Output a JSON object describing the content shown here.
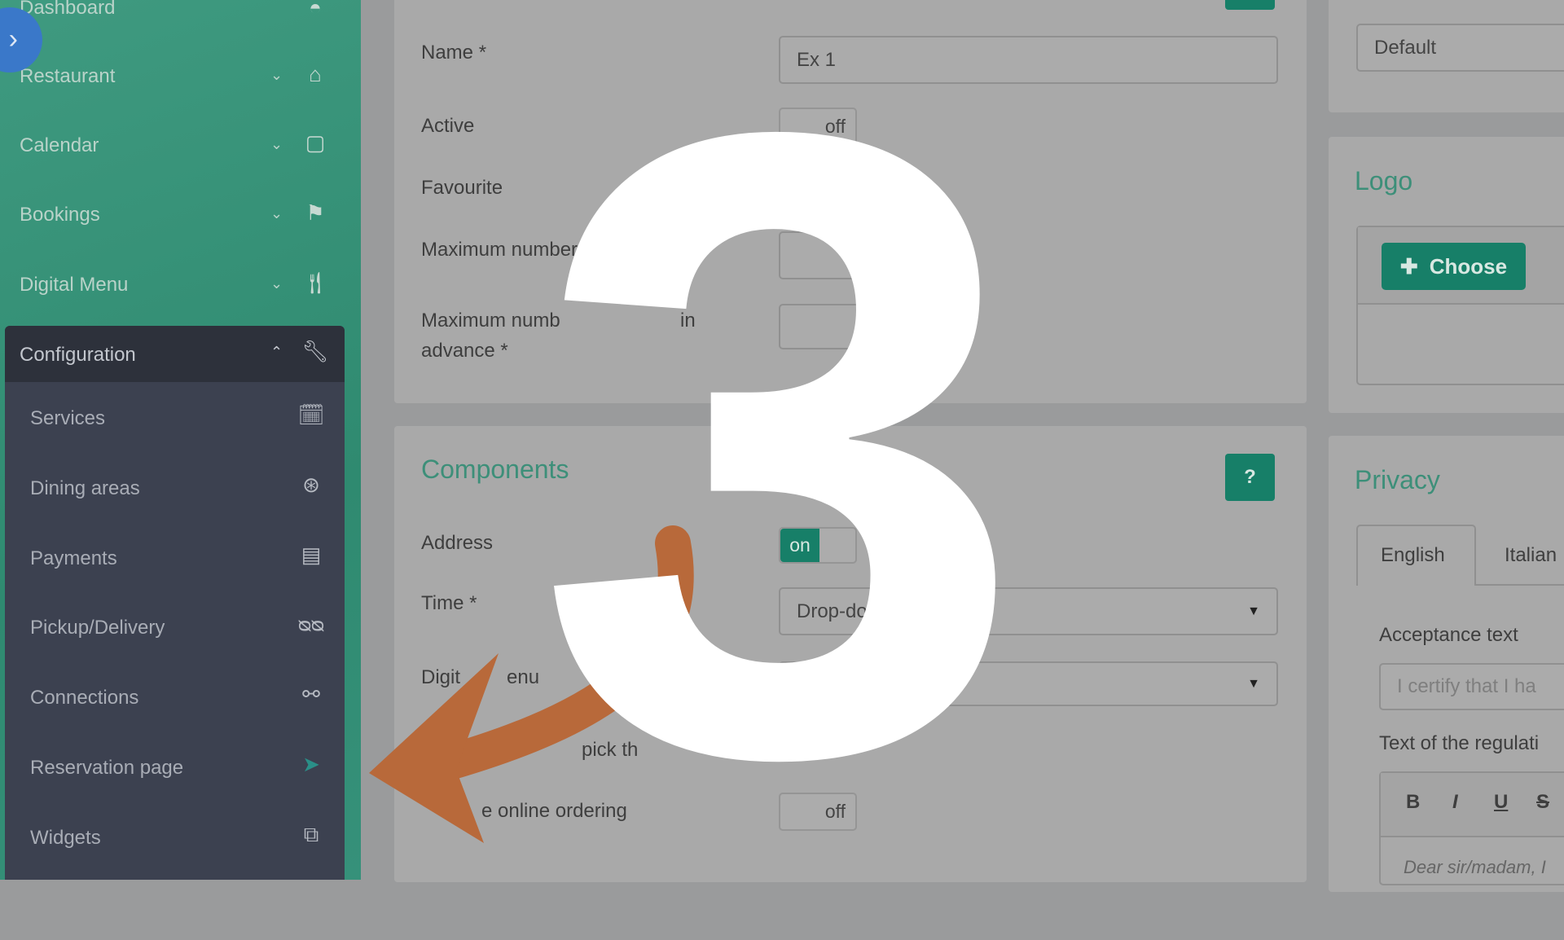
{
  "sidebar": {
    "items": [
      {
        "label": "Dashboard",
        "icon": "dashboard-icon"
      },
      {
        "label": "Restaurant",
        "icon": "home-icon"
      },
      {
        "label": "Calendar",
        "icon": "calendar-icon"
      },
      {
        "label": "Bookings",
        "icon": "flag-icon"
      },
      {
        "label": "Digital Menu",
        "icon": "cutlery-icon"
      }
    ],
    "config": {
      "label": "Configuration",
      "icon": "wrench-icon",
      "items": [
        {
          "label": "Services",
          "icon": "calendar-check-icon"
        },
        {
          "label": "Dining areas",
          "icon": "dining-area-icon"
        },
        {
          "label": "Payments",
          "icon": "credit-card-icon"
        },
        {
          "label": "Pickup/Delivery",
          "icon": "bicycle-icon"
        },
        {
          "label": "Connections",
          "icon": "connections-icon"
        },
        {
          "label": "Reservation page",
          "icon": "cursor-icon"
        },
        {
          "label": "Widgets",
          "icon": "widgets-icon"
        }
      ]
    }
  },
  "general": {
    "name_label": "Name *",
    "name_value": "Ex 1",
    "active_label": "Active",
    "active_value": "off",
    "favourite_label": "Favourite",
    "max_label": "Maximum number",
    "max_adv_label_1": "Maximum numb",
    "max_adv_label_2": "in",
    "max_adv_label_3": "advance *"
  },
  "components": {
    "title": "Components",
    "help": "?",
    "address_label": "Address",
    "address_value": "on",
    "time_label": "Time *",
    "time_value": "Drop-do",
    "menu_label_1": "Digit",
    "menu_label_2": "enu",
    "menu_placeholder": "Digit",
    "pick_label": "pick th",
    "ordering_label": "e online ordering",
    "ordering_value": "off"
  },
  "right": {
    "default_value": "Default",
    "logo_title": "Logo",
    "choose_label": "Choose",
    "privacy_title": "Privacy",
    "tabs": [
      "English",
      "Italian"
    ],
    "acceptance_label": "Acceptance text",
    "acceptance_placeholder": "I certify that I ha",
    "regulation_label": "Text of the regulati",
    "toolbar": [
      "B",
      "I",
      "U",
      "S"
    ],
    "editor_text": "Dear sir/madam, I"
  },
  "overlay": {
    "step_number": "3",
    "arrow_color": "#b8693a"
  },
  "colors": {
    "accent": "#177f68",
    "sidebar": "#2f8a70",
    "config_panel": "#3c4150",
    "expand_button": "#3a78c9"
  }
}
